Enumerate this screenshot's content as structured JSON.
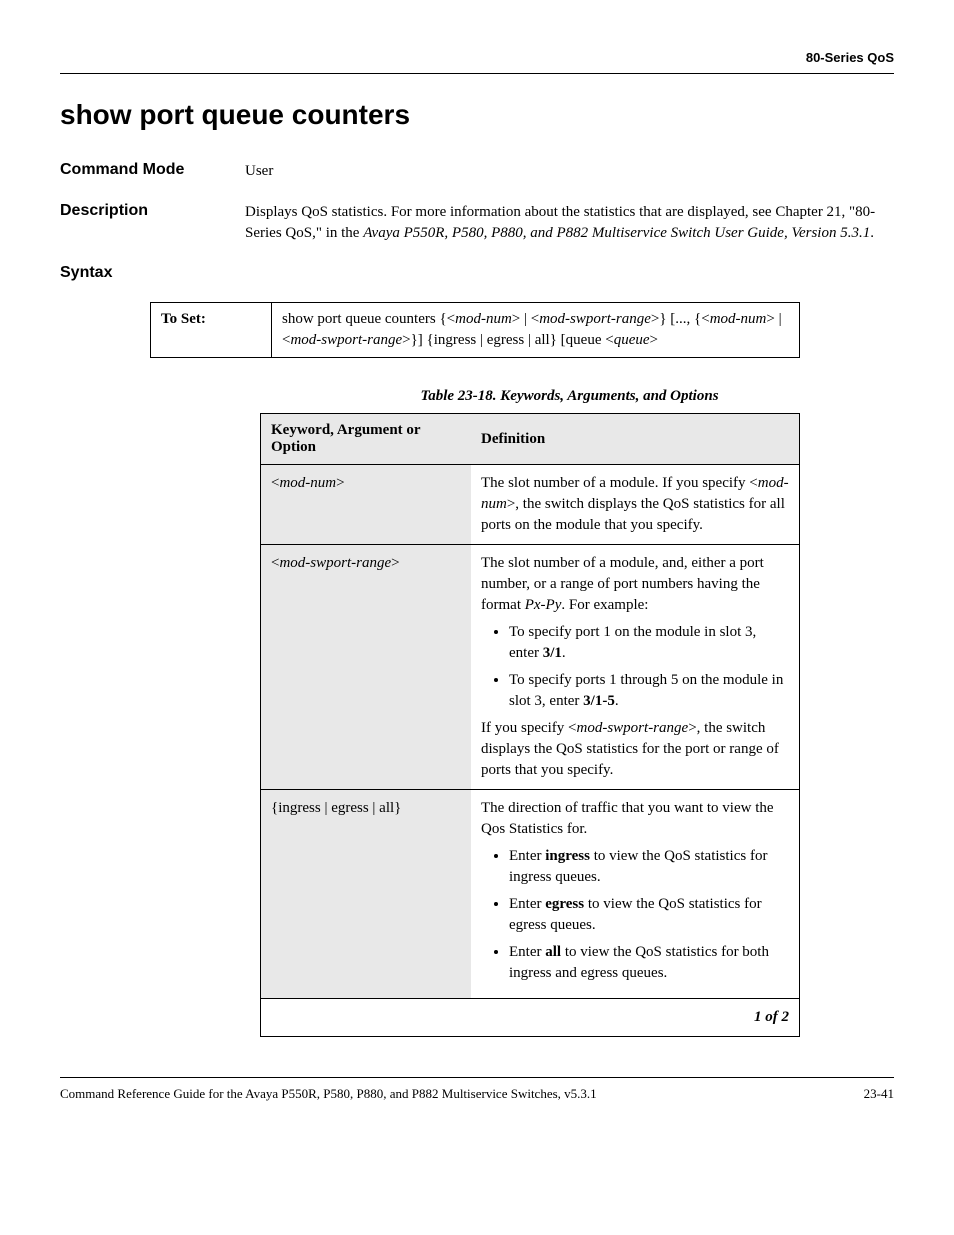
{
  "header": {
    "right": "80-Series QoS"
  },
  "title": "show port queue counters",
  "sections": {
    "commandMode": {
      "label": "Command Mode",
      "value": "User"
    },
    "description": {
      "label": "Description",
      "text_pre": "Displays QoS statistics. For more information about the statistics that are displayed, see Chapter 21, \"80-Series QoS,\" in the ",
      "text_italic": "Avaya P550R, P580, P880, and P882 Multiservice Switch User Guide, Version 5.3.1",
      "text_post": "."
    },
    "syntax": {
      "label": "Syntax"
    }
  },
  "syntaxTable": {
    "setLabel": "To Set:",
    "command_pre": "show port queue counters {<",
    "p1": "mod-num",
    "m1": "> | <",
    "p2": "mod-swport-range",
    "m2": ">} [..., {<",
    "p3": "mod-num",
    "m3": "> | <",
    "p4": "mod-swport-range",
    "m4": ">}] {ingress | egress | all} [queue <",
    "p5": "queue",
    "m5": ">"
  },
  "tableCaption": "Table 23-18.  Keywords, Arguments, and Options",
  "argsTable": {
    "head1": "Keyword, Argument or Option",
    "head2": "Definition",
    "rows": [
      {
        "kw_pre": "<",
        "kw_it": "mod-num",
        "kw_post": ">",
        "def_pre": "The slot number of a module. If you specify <",
        "def_it": "mod-num",
        "def_post": ">, the switch displays the QoS statistics for all ports on the module that you specify."
      },
      {
        "kw_pre": "<",
        "kw_it": "mod-swport-range",
        "kw_post": ">",
        "def_p1_pre": "The slot number of a module, and, either a port number, or a range of port numbers having the format ",
        "def_p1_it": "Px-Py",
        "def_p1_post": ". For example:",
        "b1_pre": "To specify port 1 on the module in slot 3, enter ",
        "b1_b": "3/1",
        "b1_post": ".",
        "b2_pre": "To specify ports 1 through 5 on the module in slot 3, enter ",
        "b2_b": "3/1-5",
        "b2_post": ".",
        "def_p2_pre": "If you specify <",
        "def_p2_it": "mod-swport-range",
        "def_p2_post": ">, the switch displays the QoS statistics for the port or range of ports that you specify."
      },
      {
        "kw": "{ingress | egress | all}",
        "def_p1": "The direction of traffic that you want to view the Qos Statistics for.",
        "b1_pre": "Enter ",
        "b1_b": "ingress",
        "b1_post": " to view the QoS statistics for ingress queues.",
        "b2_pre": "Enter ",
        "b2_b": "egress",
        "b2_post": " to view the QoS statistics for egress queues.",
        "b3_pre": "Enter ",
        "b3_b": "all",
        "b3_post": " to view the QoS statistics for both ingress and egress queues."
      }
    ],
    "pager": "1 of 2"
  },
  "footer": {
    "left": "Command Reference Guide for the Avaya P550R, P580, P880, and P882 Multiservice Switches, v5.3.1",
    "right": "23-41"
  }
}
